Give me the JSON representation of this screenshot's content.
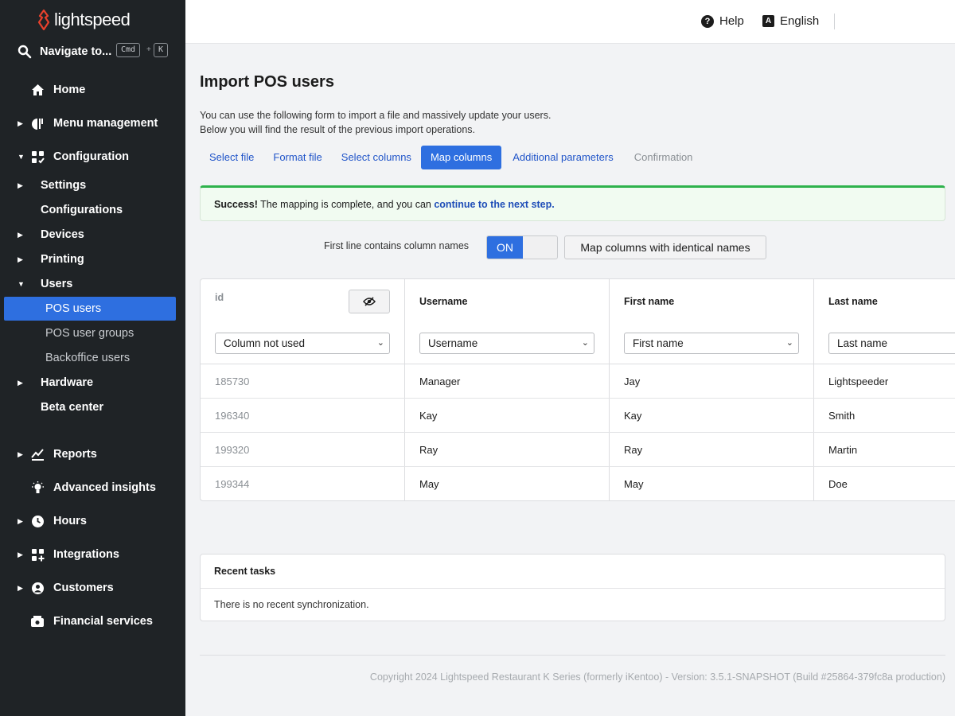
{
  "brand": {
    "name": "lightspeed",
    "color": "#e8412c"
  },
  "navigate": {
    "label": "Navigate to...",
    "kbd_cmd": "Cmd",
    "kbd_plus": "+",
    "kbd_key": "K"
  },
  "sidebar": {
    "home": "Home",
    "menu_management": "Menu management",
    "configuration": "Configuration",
    "settings": "Settings",
    "configurations": "Configurations",
    "devices": "Devices",
    "printing": "Printing",
    "users": "Users",
    "pos_users": "POS users",
    "pos_user_groups": "POS user groups",
    "backoffice_users": "Backoffice users",
    "hardware": "Hardware",
    "beta_center": "Beta center",
    "reports": "Reports",
    "advanced_insights": "Advanced insights",
    "hours": "Hours",
    "integrations": "Integrations",
    "customers": "Customers",
    "financial_services": "Financial services"
  },
  "topbar": {
    "help": "Help",
    "language": "English",
    "lang_icon": "A"
  },
  "page": {
    "title": "Import POS users",
    "desc1": "You can use the following form to import a file and massively update your users.",
    "desc2": "Below you will find the result of the previous import operations."
  },
  "tabs": [
    "Select file",
    "Format file",
    "Select columns",
    "Map columns",
    "Additional parameters",
    "Confirmation"
  ],
  "alert": {
    "strong": "Success!",
    "text": " The mapping is complete, and you can ",
    "link": "continue to the next step."
  },
  "options": {
    "first_line_label": "First line contains column names",
    "toggle_state": "ON",
    "map_button": "Map columns with identical names"
  },
  "table": {
    "columns": [
      {
        "title": "id",
        "select": "Column not used"
      },
      {
        "title": "Username",
        "select": "Username"
      },
      {
        "title": "First name",
        "select": "First name"
      },
      {
        "title": "Last name",
        "select": "Last name"
      }
    ],
    "rows": [
      [
        "185730",
        "Manager",
        "Jay",
        "Lightspeeder"
      ],
      [
        "196340",
        "Kay",
        "Kay",
        "Smith"
      ],
      [
        "199320",
        "Ray",
        "Ray",
        "Martin"
      ],
      [
        "199344",
        "May",
        "May",
        "Doe"
      ]
    ]
  },
  "recent": {
    "title": "Recent tasks",
    "empty": "There is no recent synchronization."
  },
  "footer": "Copyright 2024 Lightspeed Restaurant K Series (formerly iKentoo) - Version: 3.5.1-SNAPSHOT (Build #25864-379fc8a production)"
}
